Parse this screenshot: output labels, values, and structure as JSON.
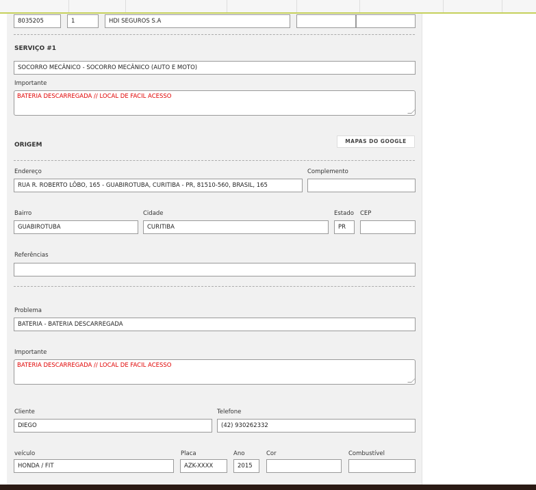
{
  "header": {
    "code": "8035205",
    "qty": "1",
    "insurer": "HDI SEGUROS S.A",
    "extra1": "",
    "extra2": ""
  },
  "service": {
    "title": "SERVIÇO #1",
    "value": "SOCORRO MECÂNICO - SOCORRO MECÂNICO (AUTO E MOTO)",
    "important_label": "Importante",
    "important": "BATERIA DESCARREGADA // LOCAL DE FACIL ACESSO"
  },
  "origin": {
    "title": "ORIGEM",
    "maps_button": "MAPAS DO GOOGLE",
    "address_label": "Endereço",
    "address": "RUA R. ROBERTO LÔBO, 165 - GUABIROTUBA, CURITIBA - PR, 81510-560, BRASIL, 165",
    "complement_label": "Complemento",
    "complement": "",
    "district_label": "Bairro",
    "district": "GUABIROTUBA",
    "city_label": "Cidade",
    "city": "CURITIBA",
    "state_label": "Estado",
    "state": "PR",
    "zip_label": "CEP",
    "zip": "",
    "references_label": "Referências",
    "references": ""
  },
  "problem": {
    "label": "Problema",
    "value": "BATERIA - BATERIA DESCARREGADA",
    "important_label": "Importante",
    "important": "BATERIA DESCARREGADA // LOCAL DE FACIL ACESSO"
  },
  "client": {
    "name_label": "Cliente",
    "name": "DIEGO",
    "phone_label": "Telefone",
    "phone": "(42) 930262332"
  },
  "vehicle": {
    "model_label": "veículo",
    "model": "HONDA / FIT",
    "plate_label": "Placa",
    "plate": "AZK-XXXX",
    "year_label": "Ano",
    "year": "2015",
    "color_label": "Cor",
    "color": "",
    "fuel_label": "Combustível",
    "fuel": ""
  }
}
